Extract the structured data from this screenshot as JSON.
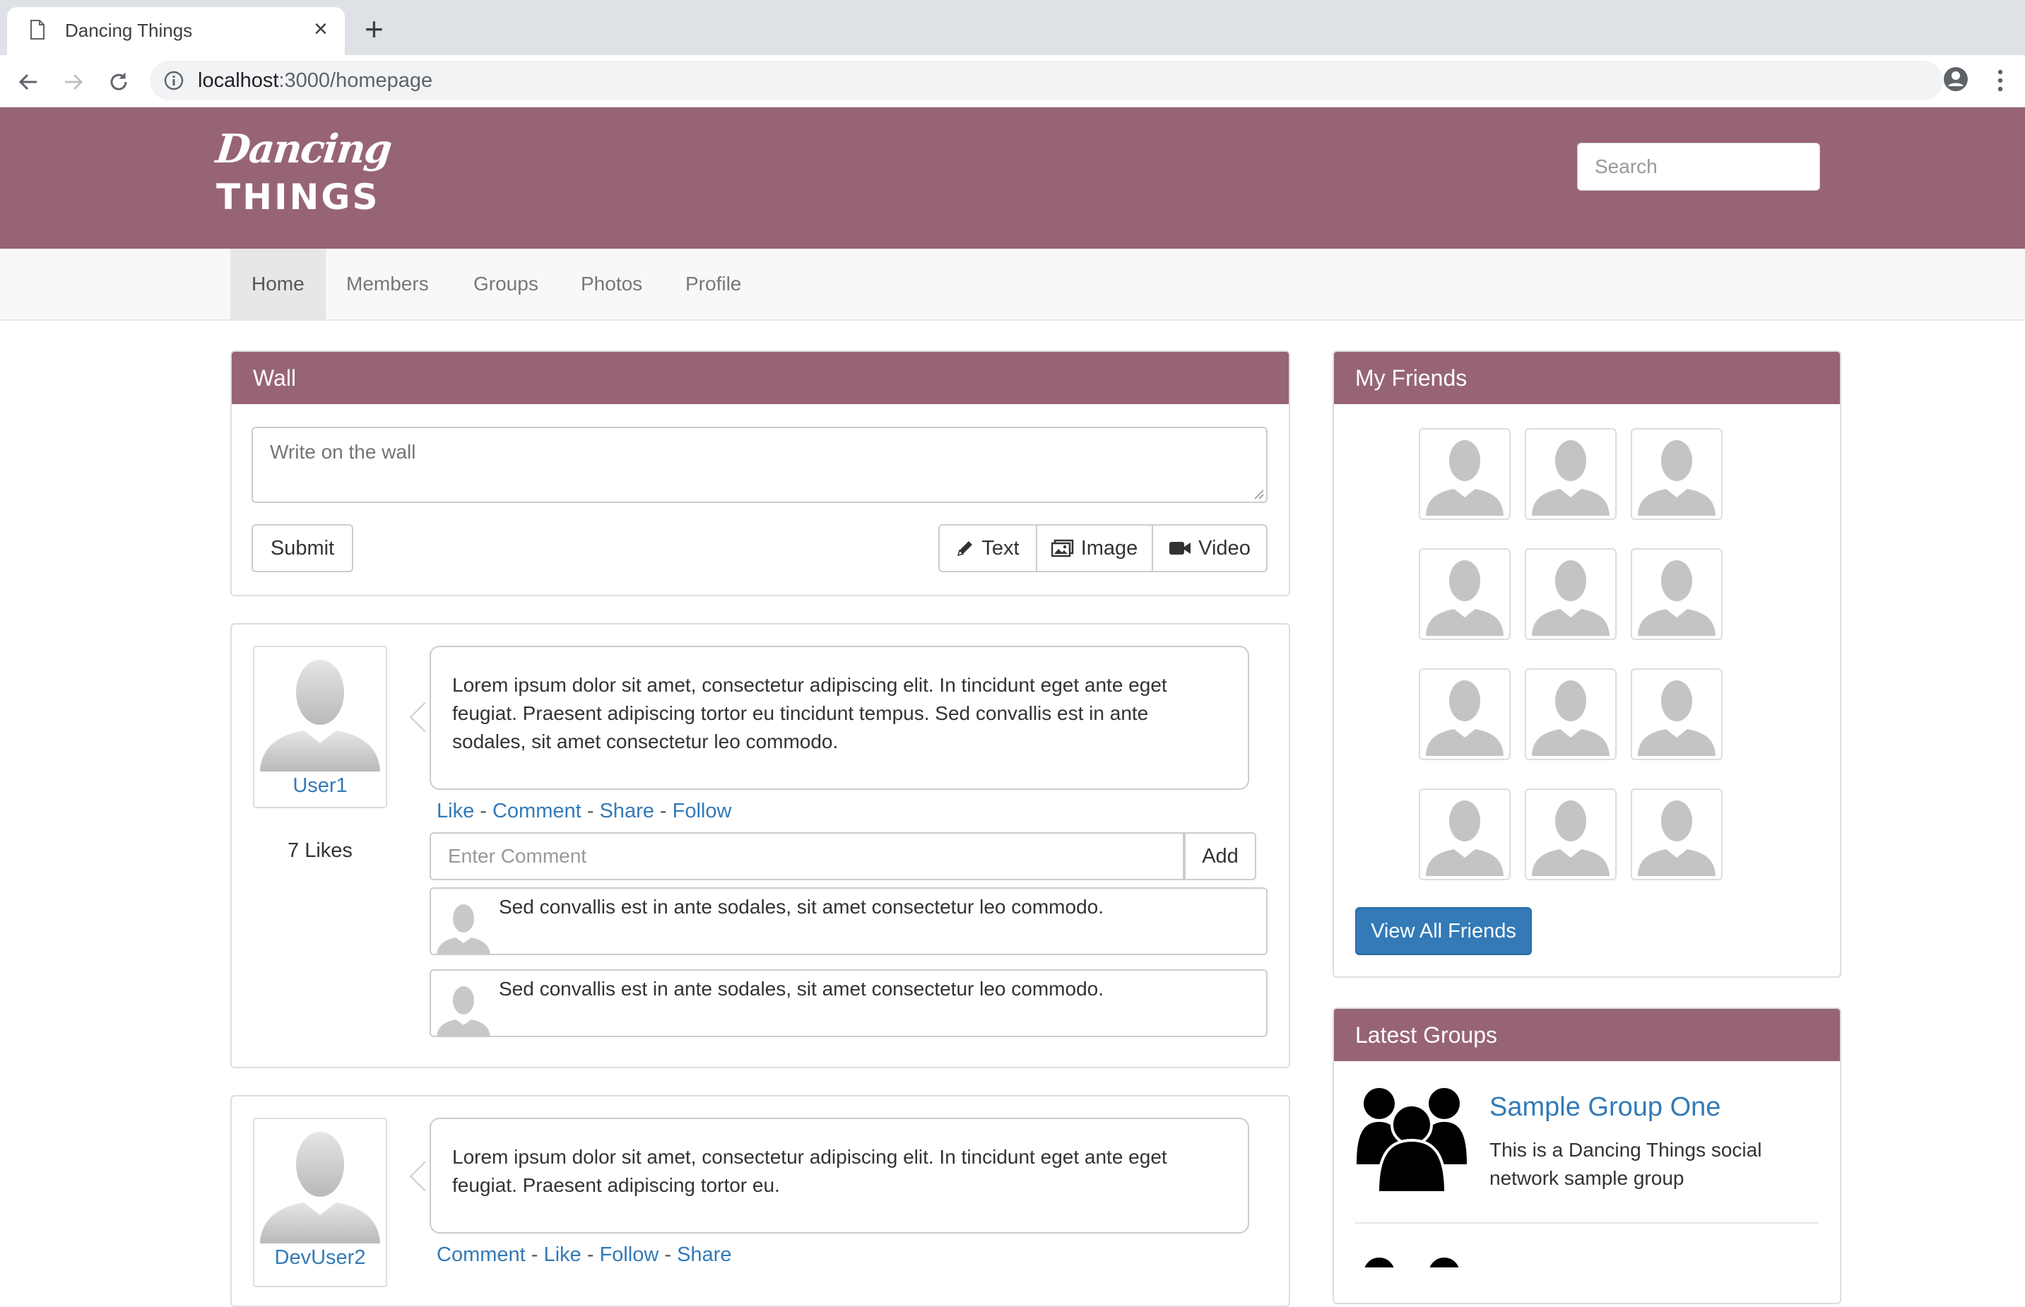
{
  "browser": {
    "tab_title": "Dancing Things",
    "url_host": "localhost",
    "url_path": ":3000/homepage"
  },
  "header": {
    "logo_line1": "Dancing",
    "logo_line2": "THINGS",
    "search_placeholder": "Search"
  },
  "nav": {
    "items": [
      {
        "label": "Home",
        "active": true
      },
      {
        "label": "Members"
      },
      {
        "label": "Groups"
      },
      {
        "label": "Photos"
      },
      {
        "label": "Profile"
      }
    ]
  },
  "wall": {
    "title": "Wall",
    "placeholder": "Write on the wall",
    "submit_label": "Submit",
    "type_buttons": [
      {
        "label": "Text",
        "icon": "pencil-icon"
      },
      {
        "label": "Image",
        "icon": "image-icon"
      },
      {
        "label": "Video",
        "icon": "video-camera-icon"
      }
    ]
  },
  "posts": [
    {
      "user": "User1",
      "likes": "7 Likes",
      "text": "Lorem ipsum dolor sit amet, consectetur adipiscing elit. In tincidunt eget ante eget feugiat. Praesent adipiscing tortor eu tincidunt tempus. Sed convallis est in ante sodales, sit amet consectetur leo commodo.",
      "lines": [
        "Lorem ipsum dolor sit amet, consectetur adipiscing elit. In tincidunt eget ante eget",
        "feugiat. Praesent adipiscing tortor eu tincidunt tempus. Sed convallis est in ante",
        "sodales, sit amet consectetur leo commodo."
      ],
      "actions": [
        "Like",
        "Comment",
        "Share",
        "Follow"
      ],
      "comment_placeholder": "Enter Comment",
      "add_label": "Add",
      "comments": [
        "Sed convallis est in ante sodales, sit amet consectetur leo commodo.",
        "Sed convallis est in ante sodales, sit amet consectetur leo commodo."
      ]
    },
    {
      "user": "DevUser2",
      "lines": [
        "Lorem ipsum dolor sit amet, consectetur adipiscing elit. In tincidunt eget ante eget",
        "feugiat. Praesent adipiscing tortor eu."
      ],
      "actions": [
        "Comment",
        "Like",
        "Follow",
        "Share"
      ]
    }
  ],
  "friends": {
    "title": "My Friends",
    "count": 12,
    "view_all_label": "View All Friends"
  },
  "groups": {
    "title": "Latest Groups",
    "items": [
      {
        "name": "Sample Group One",
        "desc_line1": "This is a Dancing Things social",
        "desc_line2": "network sample group",
        "icon": "users-group-icon"
      }
    ]
  },
  "colors": {
    "brand": "#976477",
    "link": "#337ab7",
    "primary_button": "#337ab7"
  }
}
